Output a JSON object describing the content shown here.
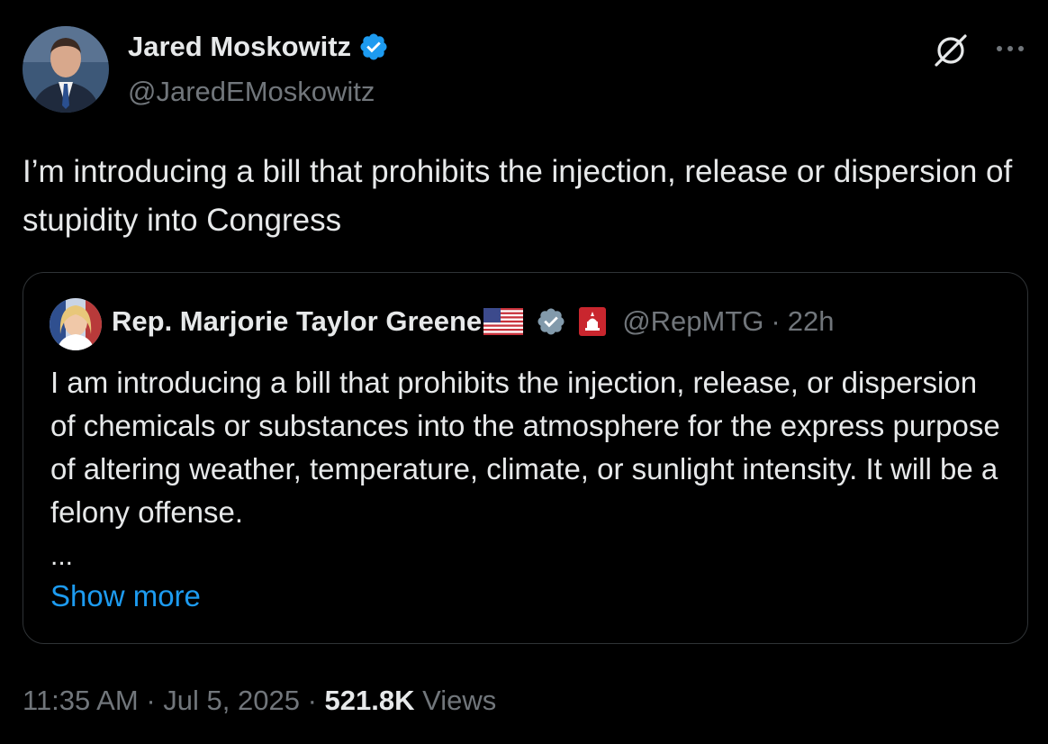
{
  "author": {
    "name": "Jared Moskowitz",
    "handle": "@JaredEMoskowitz",
    "verified": true
  },
  "tweet": {
    "text": "I’m introducing a bill that prohibits the injection, release or dispersion of stupidity into Congress"
  },
  "quoted": {
    "name": "Rep. Marjorie Taylor Greene",
    "handle": "@RepMTG",
    "separator": "·",
    "time": "22h",
    "text": "I am introducing a bill that prohibits the injection, release, or dispersion of chemicals or substances into the atmosphere for the express purpose of altering weather, temperature, climate, or sunlight intensity. It will be a felony offense.",
    "ellipsis": "...",
    "show_more": "Show more"
  },
  "meta": {
    "time": "11:35 AM",
    "sep1": "·",
    "date": "Jul 5, 2025",
    "sep2": "·",
    "views_count": "521.8K",
    "views_label": "Views"
  },
  "colors": {
    "background": "#000000",
    "text": "#e7e9ea",
    "secondary": "#71767b",
    "link": "#1d9bf0",
    "verified": "#1d9bf0",
    "border": "#2f3336"
  }
}
